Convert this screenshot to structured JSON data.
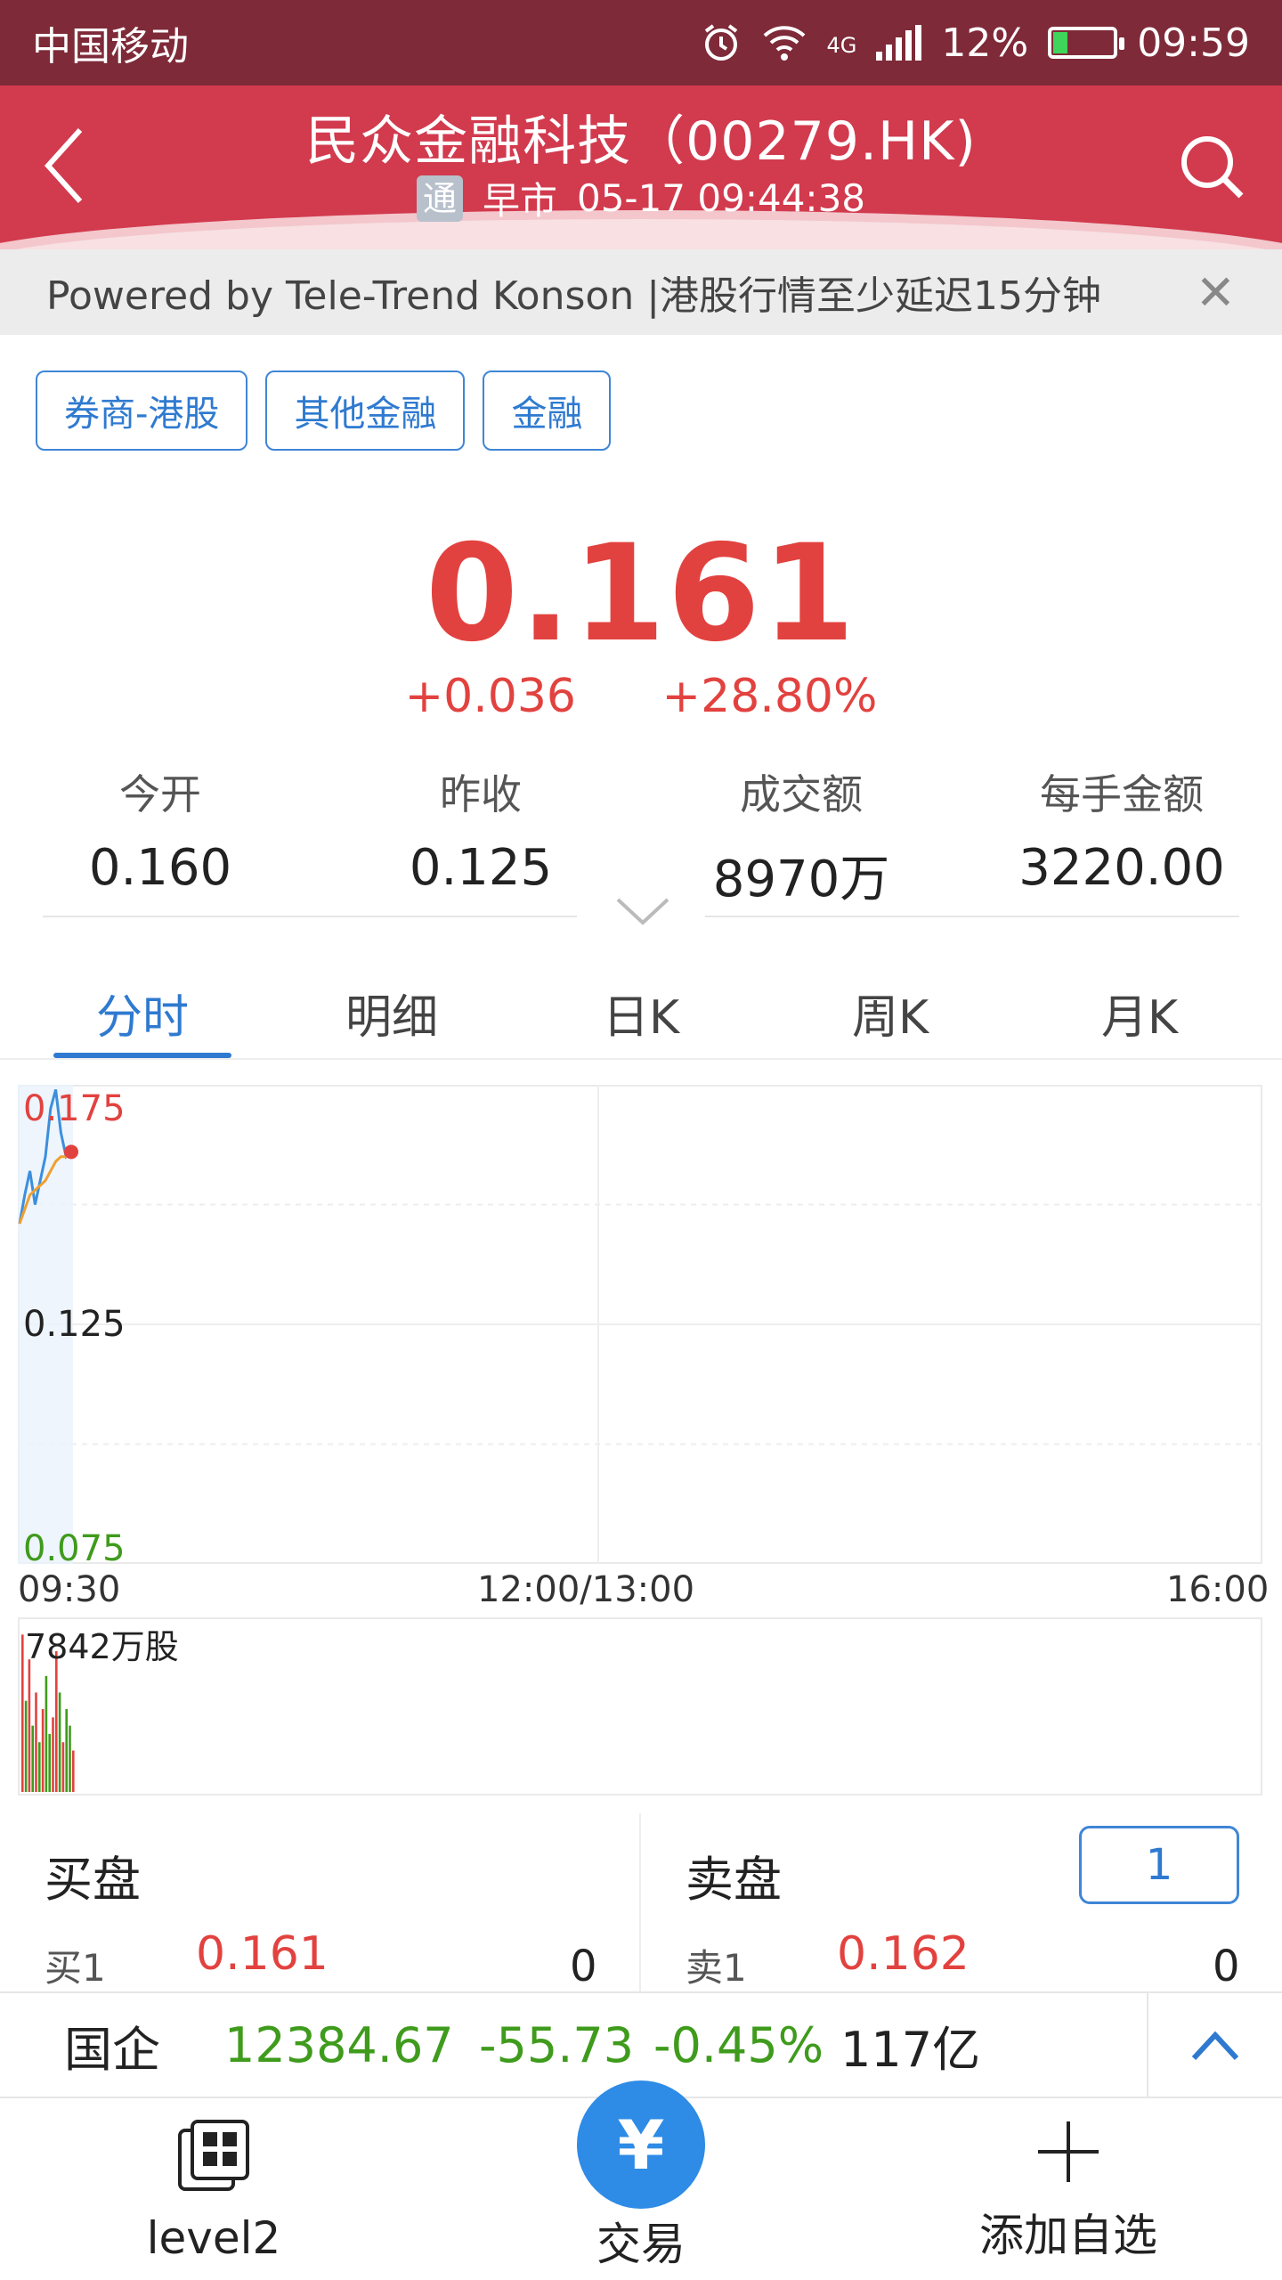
{
  "status_bar": {
    "carrier": "中国移动",
    "network": "4G",
    "battery": "12%",
    "time": "09:59"
  },
  "header": {
    "title": "民众金融科技（00279.HK)",
    "tong_badge": "通",
    "session": "早市",
    "datetime": "05-17  09:44:38"
  },
  "notice": {
    "text": "Powered by Tele-Trend Konson |港股行情至少延迟15分钟",
    "close": "✕"
  },
  "tags": [
    "券商-港股",
    "其他金融",
    "金融"
  ],
  "quote": {
    "price": "0.161",
    "change": "+0.036",
    "change_pct": "+28.80%"
  },
  "stats": [
    {
      "label": "今开",
      "value": "0.160"
    },
    {
      "label": "昨收",
      "value": "0.125"
    },
    {
      "label": "成交额",
      "value": "8970万"
    },
    {
      "label": "每手金额",
      "value": "3220.00"
    }
  ],
  "tabs": [
    "分时",
    "明细",
    "日K",
    "周K",
    "月K"
  ],
  "chart_data": {
    "type": "line",
    "title": "",
    "y_labels": {
      "top": "0.175",
      "mid": "0.125",
      "bottom": "0.075"
    },
    "ylim": [
      0.075,
      0.175
    ],
    "x_labels": [
      "09:30",
      "12:00/13:00",
      "16:00"
    ],
    "series": [
      {
        "values": [
          0.146,
          0.152,
          0.157,
          0.15,
          0.155,
          0.16,
          0.17,
          0.174,
          0.165,
          0.16,
          0.161
        ]
      },
      {
        "values": [
          0.146,
          0.149,
          0.152,
          0.153,
          0.154,
          0.155,
          0.157,
          0.159,
          0.16,
          0.16,
          0.161
        ]
      }
    ],
    "volume_label": "7842万股",
    "volume": [
      0.95,
      0.55,
      0.8,
      0.4,
      0.6,
      0.3,
      0.5,
      0.7,
      0.35,
      0.45,
      0.85,
      0.6,
      0.3,
      0.5,
      0.4,
      0.25
    ],
    "volume_colors": [
      "r",
      "g",
      "r",
      "g",
      "r",
      "g",
      "r",
      "g",
      "g",
      "r",
      "r",
      "g",
      "r",
      "g",
      "g",
      "r"
    ],
    "colors": {
      "price_line": "#3b8fdc",
      "avg_line": "#f0a030",
      "up": "#e2423f",
      "down": "#3f9b1c"
    }
  },
  "order_book": {
    "bid_title": "买盘",
    "ask_title": "卖盘",
    "level_selector": "1",
    "bid": {
      "level": "买1",
      "price": "0.161",
      "qty": "0"
    },
    "ask": {
      "level": "卖1",
      "price": "0.162",
      "qty": "0"
    }
  },
  "index_bar": {
    "name": "国企",
    "value": "12384.67",
    "change": "-55.73",
    "change_pct": "-0.45%",
    "turnover": "117亿"
  },
  "bottom_nav": {
    "level2": "level2",
    "trade": "交易",
    "trade_icon": "¥",
    "add_watch": "添加自选"
  }
}
